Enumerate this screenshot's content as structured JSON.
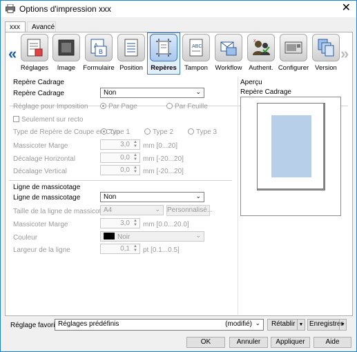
{
  "window": {
    "title": "Options d'impression xxx",
    "close_glyph": "✕"
  },
  "tabs": [
    {
      "label": "xxx",
      "active": true
    },
    {
      "label": "Avancé",
      "active": false
    }
  ],
  "toolbar": {
    "prev_arrow": "«",
    "next_arrow": "»",
    "items": [
      {
        "label": "Réglages",
        "icon": "settings-doc-icon"
      },
      {
        "label": "Image",
        "icon": "image-icon"
      },
      {
        "label": "Formulaire",
        "icon": "form-icon"
      },
      {
        "label": "Position",
        "icon": "position-icon"
      },
      {
        "label": "Repères",
        "icon": "crop-marks-icon",
        "selected": true
      },
      {
        "label": "Tampon",
        "icon": "stamp-icon"
      },
      {
        "label": "Workflow",
        "icon": "workflow-icon"
      },
      {
        "label": "Authent.",
        "icon": "authentication-icon"
      },
      {
        "label": "Configurer",
        "icon": "printer-config-icon"
      },
      {
        "label": "Version",
        "icon": "version-icon"
      }
    ]
  },
  "crop_marks": {
    "group_title": "Repère Cadrage",
    "crop_mark_label": "Repère Cadrage",
    "crop_mark_value": "Non",
    "imposition_label": "Réglage pour Imposition",
    "per_page": "Par Page",
    "per_sheet": "Par Feuille",
    "front_only": "Seulement sur recto",
    "corner_type_label": "Type de Repère de Coupe en Coin",
    "type1": "Type 1",
    "type2": "Type 2",
    "type3": "Type 3",
    "trim_margin_label": "Massicoter Marge",
    "trim_margin_value": "3,0",
    "trim_margin_unit": "mm [0...20]",
    "h_offset_label": "Décalage Horizontal",
    "h_offset_value": "0,0",
    "h_offset_unit": "mm [-20...20]",
    "v_offset_label": "Décalage Vertical",
    "v_offset_value": "0,0",
    "v_offset_unit": "mm [-20...20]"
  },
  "trim_line": {
    "group_title": "Ligne de massicotage",
    "trim_line_label": "Ligne de massicotage",
    "trim_line_value": "Non",
    "size_label": "Taille de la ligne de massicotage",
    "size_value": "A4",
    "custom_button": "Personnalisé...",
    "margin_label": "Massicoter Marge",
    "margin_value": "3,0",
    "margin_unit": "mm [0.0...20.0]",
    "color_label": "Couleur",
    "color_value": "Noir",
    "width_label": "Largeur de la ligne",
    "width_value": "0,1",
    "width_unit": "pt [0.1...0.5]"
  },
  "preview": {
    "title": "Aperçu",
    "subtitle": "Repère Cadrage"
  },
  "favorite": {
    "label": "Réglage favori",
    "value": "Réglages prédéfinis",
    "status": "(modifié)",
    "restore": "Rétablir",
    "save": "Enregistrer"
  },
  "buttons": {
    "ok": "OK",
    "cancel": "Annuler",
    "apply": "Appliquer",
    "help": "Aide"
  },
  "colors": {
    "accent": "#1883d7",
    "preview_image": "#b8cfea",
    "selected_tool": "#3a78c4"
  }
}
